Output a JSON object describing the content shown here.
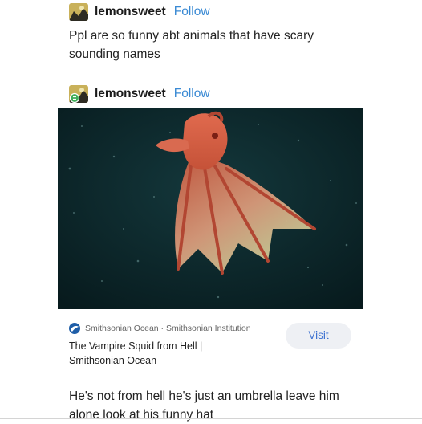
{
  "post1": {
    "username": "lemonsweet",
    "follow_label": "Follow",
    "text_line1": "Ppl are so funny abt animals that have scary",
    "text_line2": "sounding names"
  },
  "post2": {
    "username": "lemonsweet",
    "follow_label": "Follow",
    "image_subject": "vampire squid"
  },
  "link_card": {
    "source": "Smithsonian Ocean · Smithsonian Institution",
    "title_line1": "The Vampire Squid from Hell |",
    "title_line2": "Smithsonian Ocean",
    "visit_label": "Visit"
  },
  "post3": {
    "text_line1": "He's not from hell he's just an umbrella leave him",
    "text_line2": "alone look at his funny hat"
  },
  "colors": {
    "follow": "#3a8ad4",
    "visit_text": "#3a6fd0",
    "visit_bg": "#eef0f4",
    "ocean": "#0c2a2e",
    "squid": "#d8664a"
  },
  "icons": [
    "avatar",
    "reblog-icon",
    "smithsonian-logo-icon"
  ]
}
